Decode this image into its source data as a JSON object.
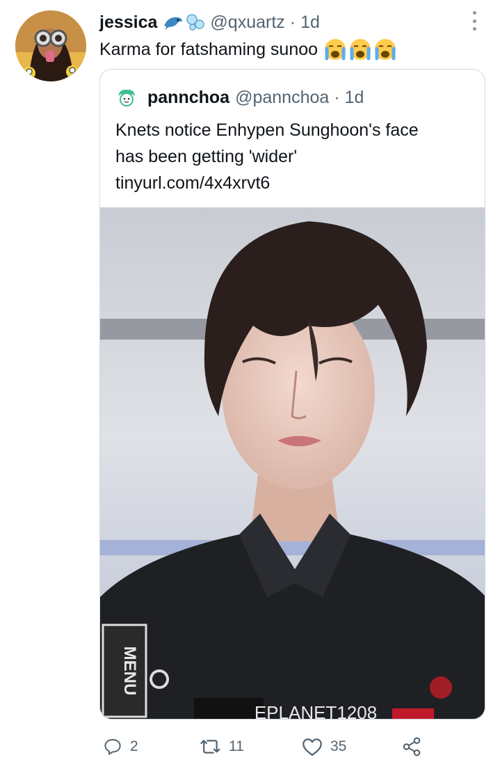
{
  "tweet": {
    "author_name": "jessica",
    "handle": "@qxuartz",
    "separator": "·",
    "time": "1d",
    "text": "Karma for fatshaming sunoo",
    "name_icons": [
      "dolphin-emoji",
      "bubbles-emoji"
    ],
    "text_emojis": [
      "loudly-crying-face-emoji",
      "loudly-crying-face-emoji",
      "loudly-crying-face-emoji"
    ]
  },
  "quote": {
    "author_name": "pannchoa",
    "handle": "@pannchoa",
    "separator": "·",
    "time": "1d",
    "lines": [
      "Knets notice Enhypen Sunghoon's face",
      "has been getting 'wider'",
      "tinyurl.com/4x4xrvt6"
    ],
    "image": {
      "overlay_text_left": "MENU",
      "overlay_text_bottom": "EPLANET1208"
    }
  },
  "actions": {
    "replies": "2",
    "retweets": "11",
    "likes": "35"
  },
  "colors": {
    "text_primary": "#0f1419",
    "text_secondary": "#536471",
    "border": "#cfd9de"
  }
}
